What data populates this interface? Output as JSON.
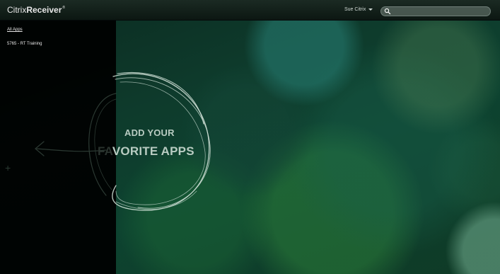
{
  "header": {
    "brand": "Citrix",
    "product": "Receiver",
    "reg_mark": "®",
    "user_name": "Sue Citrix",
    "search": {
      "value": "",
      "placeholder": ""
    }
  },
  "sidebar": {
    "items": [
      {
        "label": "All Apps",
        "selected": true
      },
      {
        "label": "5765 - RT Training",
        "selected": false
      }
    ]
  },
  "main": {
    "prompt_line1": "ADD YOUR",
    "prompt_line2_dim": "FA",
    "prompt_line2_bright": "VORITE APPS",
    "hint_icon": "+"
  },
  "colors": {
    "sidebar_bg": "#000000",
    "background": "#0d4330",
    "accent_text": "#b9ccc2"
  },
  "icons": {
    "search": "search-icon",
    "user_menu": "chevron-down-icon",
    "add_hint": "plus-icon"
  }
}
